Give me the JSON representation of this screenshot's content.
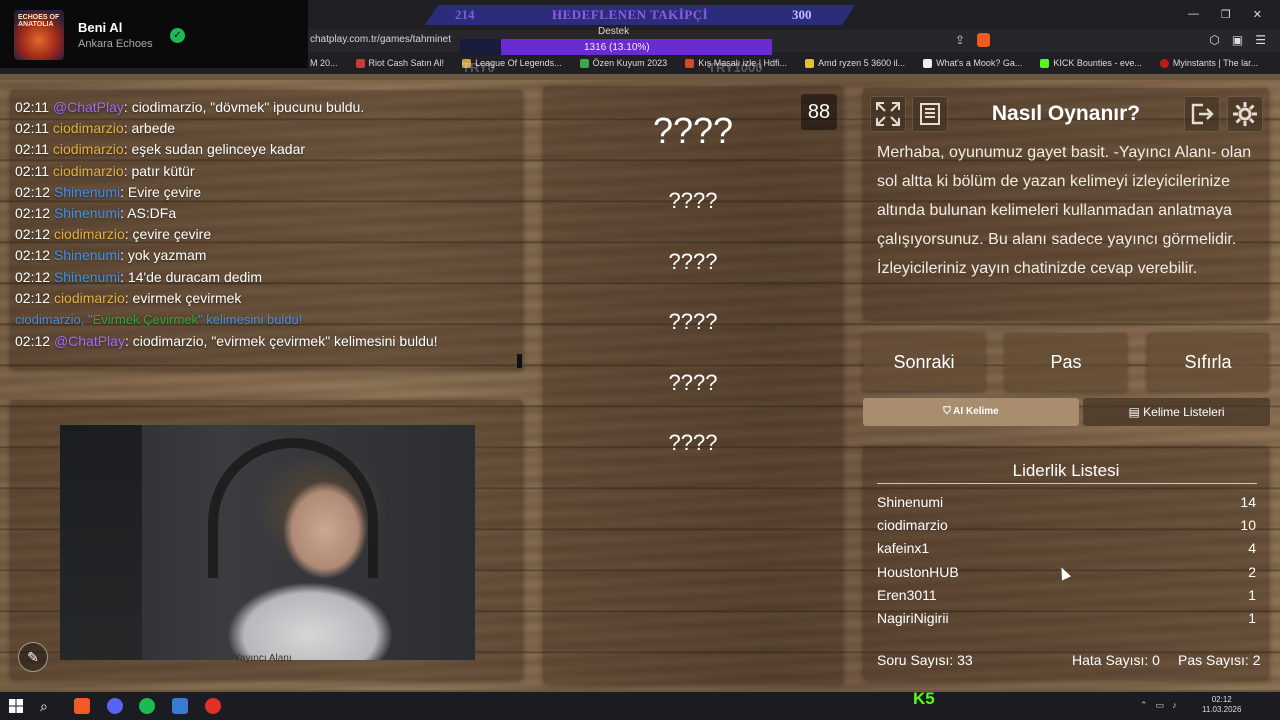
{
  "now_playing": {
    "title": "Beni Al",
    "artist": "Ankara Echoes",
    "album_art_text": "ECHOES OF ANATOLIA"
  },
  "overlay": {
    "goal_current": "214",
    "goal_label": "HEDEFLENEN TAKİPÇİ",
    "goal_target": "300",
    "support_label": "Destek",
    "support_progress_text": "1316 (13.10%)",
    "support_progress": 0.131,
    "ghost_left": "TRY0",
    "ghost_right": "TRY1000"
  },
  "browser": {
    "url": "chatplay.com.tr/games/tahminet",
    "bookmarks": [
      "M 20...",
      "Riot Cash Satın Al!",
      "League Of Legends...",
      "Özen Kuyum 2023",
      "Kış Masalı izle | Hdfi...",
      "Amd ryzen 5 3600 il...",
      "What's a Mook? Ga...",
      "KICK Bounties - eve...",
      "Myinstants | The lar..."
    ]
  },
  "chat": {
    "messages": [
      {
        "time": "02:11",
        "user": "@ChatPlay",
        "text": ": ciodimarzio, \"dövmek\" ipucunu buldu."
      },
      {
        "time": "02:11",
        "user": "ciodimarzio",
        "text": ": arbede"
      },
      {
        "time": "02:11",
        "user": "ciodimarzio",
        "text": ": eşek sudan gelinceye kadar"
      },
      {
        "time": "02:11",
        "user": "ciodimarzio",
        "text": ": patır kütür"
      },
      {
        "time": "02:12",
        "user": "Shinenumi",
        "text": ": Evire çevire"
      },
      {
        "time": "02:12",
        "user": "Shinenumi",
        "text": ": AS:DFa"
      },
      {
        "time": "02:12",
        "user": "ciodimarzio",
        "text": ": çevire çevire"
      },
      {
        "time": "02:12",
        "user": "Shinenumi",
        "text": ": yok yazmam"
      },
      {
        "time": "02:12",
        "user": "Shinenumi",
        "text": ": 14'de duracam dedim"
      },
      {
        "time": "02:12",
        "user": "ciodimarzio",
        "text": ": evirmek çevirmek"
      }
    ],
    "system": {
      "prefix": "ciodimarzio, \"",
      "word": "Evirmek Çevirmek",
      "suffix": "\" kelimesini buldu!"
    },
    "last": {
      "time": "02:12",
      "user": "@ChatPlay",
      "text": ": ciodimarzio, \"evirmek çevirmek\" kelimesini buldu!"
    }
  },
  "camera": {
    "label": "Yayıncı Alanı"
  },
  "game": {
    "timer": "88",
    "main_word": "????",
    "hidden_words": [
      "????",
      "????",
      "????",
      "????",
      "????"
    ]
  },
  "howto": {
    "title": "Nasıl Oynanır?",
    "text": "Merhaba, oyunumuz gayet basit. -Yayıncı Alanı- olan sol altta ki bölüm de yazan kelimeyi izleyicilerinize altında bulunan kelimeleri kullanmadan anlatmaya çalışıyorsunuz. Bu alanı sadece yayıncı görmelidir. İzleyicileriniz yayın chatinizde cevap verebilir."
  },
  "controls": {
    "next": "Sonraki",
    "pass": "Pas",
    "reset": "Sıfırla",
    "ai_word": "AI Kelime",
    "word_lists": "Kelime Listeleri"
  },
  "leaderboard": {
    "title": "Liderlik Listesi",
    "rows": [
      {
        "name": "Shinenumi",
        "score": "14"
      },
      {
        "name": "ciodimarzio",
        "score": "10"
      },
      {
        "name": "kafeinx1",
        "score": "4"
      },
      {
        "name": "HoustonHUB",
        "score": "2"
      },
      {
        "name": "Eren3011",
        "score": "1"
      },
      {
        "name": "NagiriNigirii",
        "score": "1"
      }
    ],
    "questions": "Soru Sayısı: 33",
    "errors": "Hata Sayısı: 0",
    "passes": "Pas Sayısı: 2"
  },
  "taskbar": {
    "time": "02:12",
    "date": "11.03.2026",
    "kick_count": "5"
  },
  "colors": {
    "bot": "#a06cf0",
    "gold": "#e0b040",
    "blue": "#3e8ff0",
    "green": "#2aa83a",
    "kick": "#53fc18"
  }
}
